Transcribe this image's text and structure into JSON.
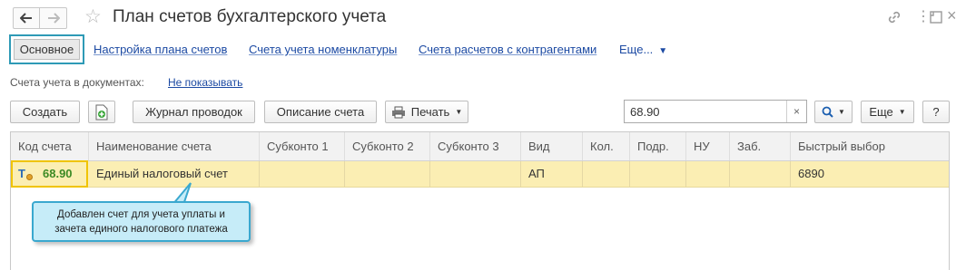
{
  "window": {
    "title": "План счетов бухгалтерского учета",
    "back_icon": "arrow-left-icon",
    "forward_icon": "arrow-right-icon",
    "favorite_icon": "star-icon",
    "link_icon": "link-icon",
    "menu_icon": "more-vertical-icon",
    "expand_icon": "expand-icon",
    "close_glyph": "×",
    "menu_glyph": "⋮"
  },
  "tabs": {
    "main": "Основное",
    "links": [
      "Настройка плана счетов",
      "Счета учета номенклатуры",
      "Счета расчетов с контрагентами"
    ],
    "more": "Еще..."
  },
  "accounts_in_documents": {
    "label": "Счета учета в документах:",
    "value": "Не показывать"
  },
  "toolbar": {
    "create": "Создать",
    "journal": "Журнал проводок",
    "description": "Описание счета",
    "print": "Печать",
    "search_value": "68.90",
    "clear_glyph": "×",
    "more": "Еще",
    "help": "?"
  },
  "table": {
    "columns": [
      "Код счета",
      "Наименование счета",
      "Субконто 1",
      "Субконто 2",
      "Субконто 3",
      "Вид",
      "Кол.",
      "Подр.",
      "НУ",
      "Заб.",
      "Быстрый выбор"
    ],
    "rows": [
      {
        "type_glyph": "Т",
        "code": "68.90",
        "name": "Единый налоговый счет",
        "subconto1": "",
        "subconto2": "",
        "subconto3": "",
        "kind": "АП",
        "qty": "",
        "dept": "",
        "nu": "",
        "offbalance": "",
        "quick": "6890"
      }
    ]
  },
  "callout": {
    "text": "Добавлен счет для учета уплаты и зачета единого налогового платежа"
  },
  "colors": {
    "accent": "#2e9ab6",
    "link": "#1c4aa3",
    "row_selected": "#fbeeb3",
    "code_green": "#3c8a25",
    "callout_bg": "#c6ecf8"
  }
}
